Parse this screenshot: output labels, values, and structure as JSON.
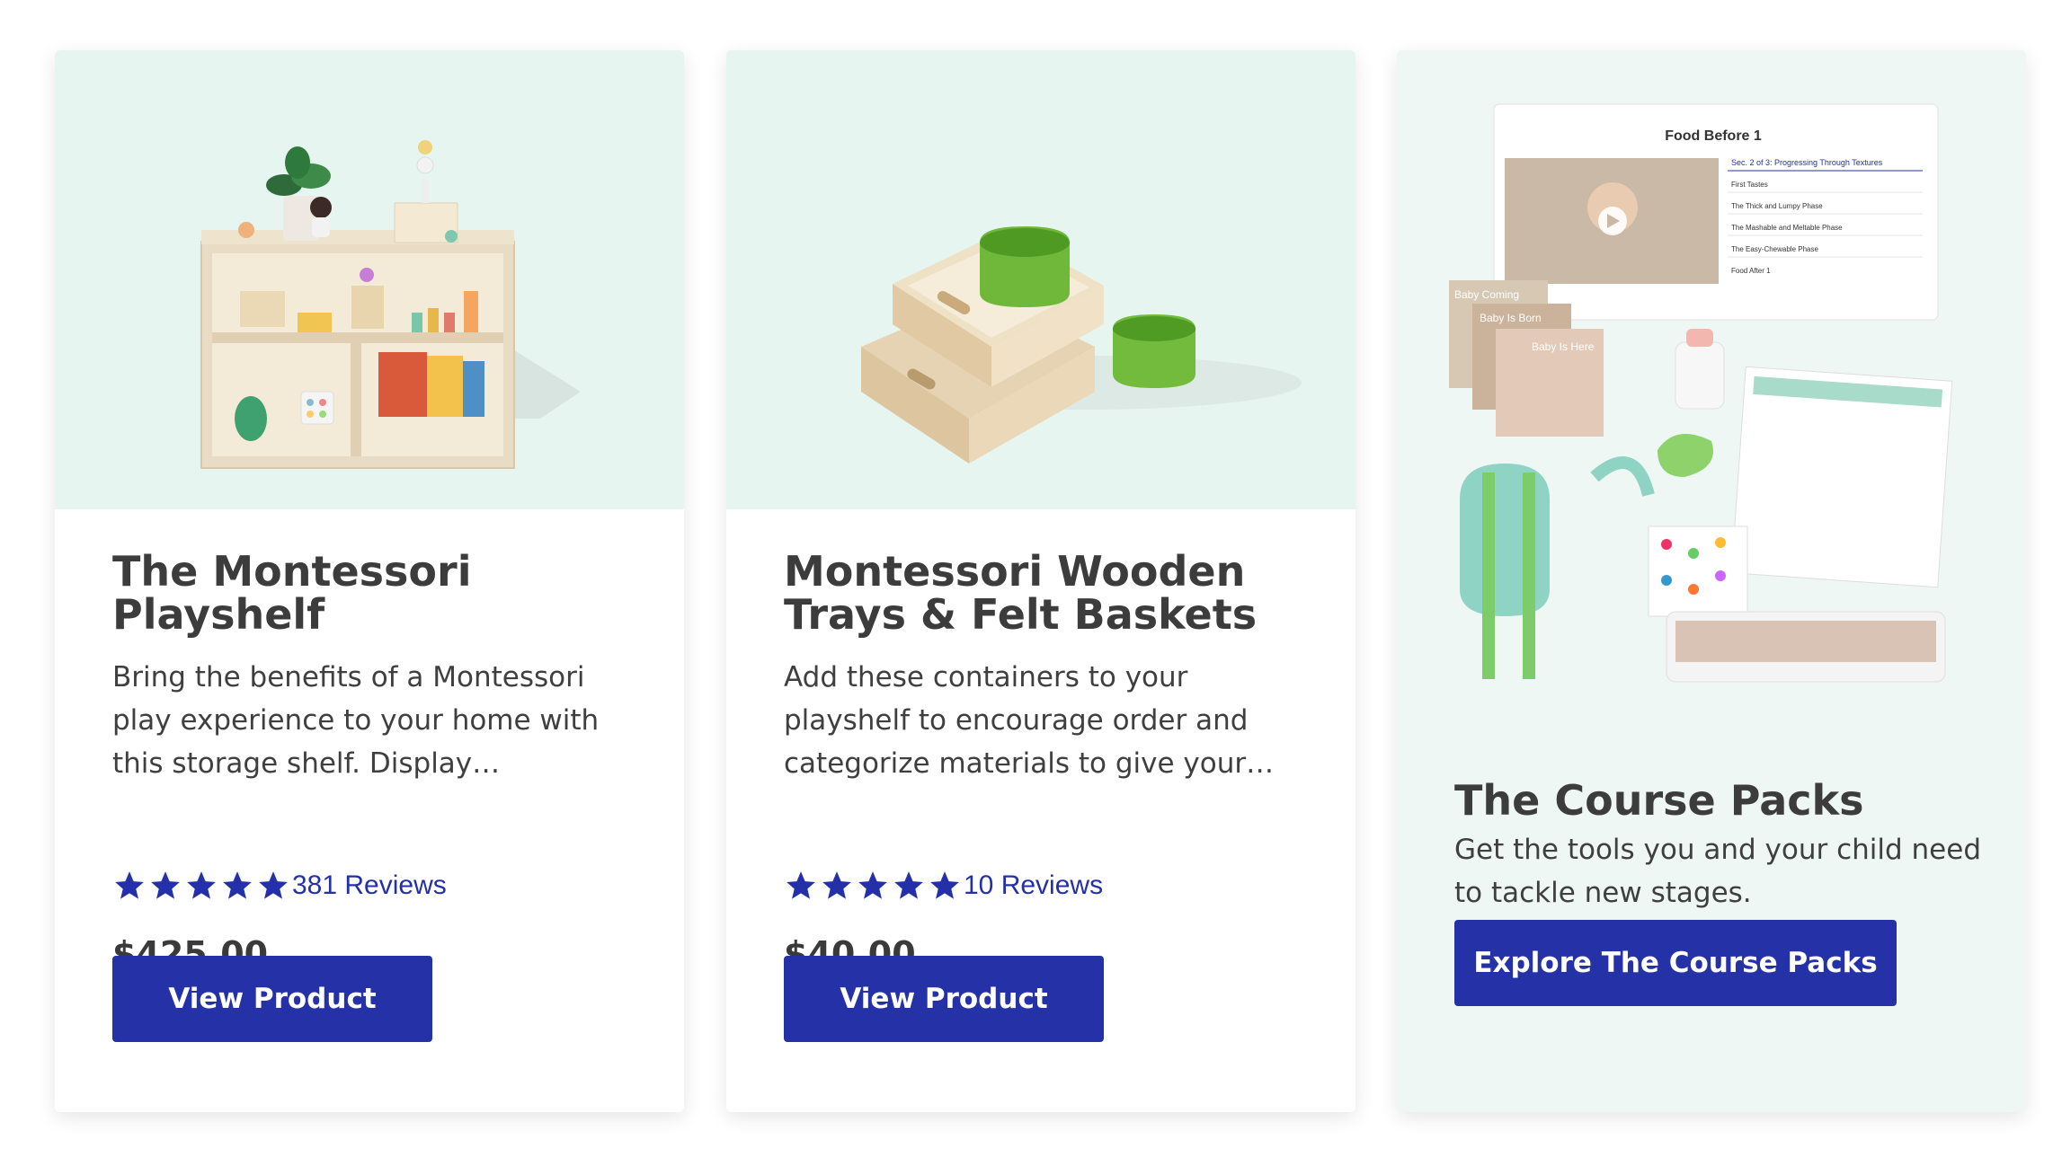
{
  "cards": [
    {
      "title": "The Montessori Playshelf",
      "description": "Bring the benefits of a Montessori play experience to your home with this storage shelf. Display…",
      "reviews_label": "381 Reviews",
      "rating": 5,
      "price": "$425.00",
      "button_label": "View Product"
    },
    {
      "title": "Montessori Wooden Trays & Felt Baskets",
      "description": "Add these containers to your playshelf to encourage order and categorize materials to give your…",
      "reviews_label": "10 Reviews",
      "rating": 5,
      "price": "$40.00",
      "button_label": "View Product"
    }
  ],
  "course_packs": {
    "title": "The Course Packs",
    "description": "Get the tools you and your child need to tackle new stages.",
    "button_label": "Explore The Course Packs",
    "preview": {
      "window_title": "Food Before 1",
      "section_label": "Sec. 2 of 3: Progressing Through Textures",
      "lessons": [
        "First Tastes",
        "The Thick and Lumpy Phase",
        "The Mashable and Meltable Phase",
        "The Easy-Chewable Phase",
        "Food After 1"
      ],
      "card_labels": [
        "Baby Coming",
        "Baby Is Born",
        "Baby Is Here"
      ]
    }
  },
  "colors": {
    "accent": "#2531a6",
    "star": "#2430a8",
    "media_bg": "#e7f5f1",
    "course_bg": "#eef7f4"
  }
}
